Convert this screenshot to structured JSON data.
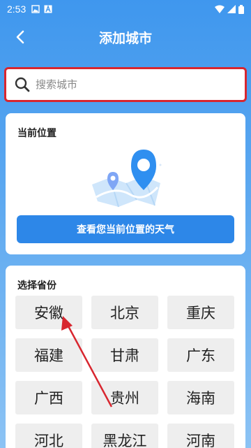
{
  "status_bar": {
    "time": "2:53",
    "left_icons": [
      "gallery-icon",
      "text-a-icon"
    ],
    "right_icons": [
      "wifi-icon",
      "cellular-icon",
      "battery-icon"
    ]
  },
  "header": {
    "title": "添加城市",
    "back_icon": "chevron-left-icon"
  },
  "search": {
    "placeholder": "搜索城市",
    "value": ""
  },
  "current_location": {
    "title": "当前位置",
    "button_label": "查看您当前位置的天气"
  },
  "provinces": {
    "title": "选择省份",
    "items": [
      "安徽",
      "北京",
      "重庆",
      "福建",
      "甘肃",
      "广东",
      "广西",
      "贵州",
      "海南",
      "河北",
      "黑龙江",
      "河南"
    ]
  },
  "colors": {
    "accent": "#2d87e8",
    "highlight_border": "#d8262f",
    "annotation_arrow": "#d8262f"
  }
}
